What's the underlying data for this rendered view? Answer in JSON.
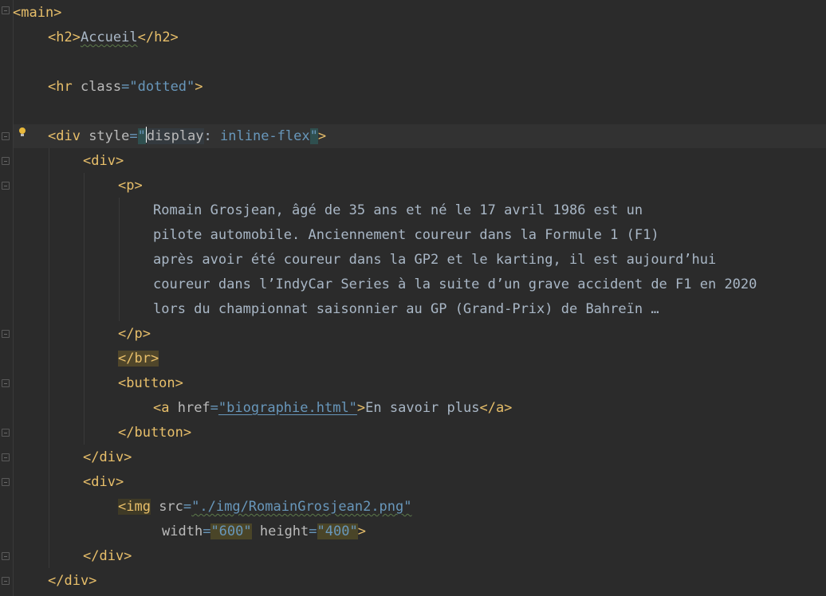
{
  "lines": {
    "l1": "<main>",
    "l2_open": "<h2>",
    "l2_text": "Accueil",
    "l2_close": "</h2>",
    "l3_tag": "<hr ",
    "l3_attr": "class",
    "l3_eq": "=",
    "l3_val": "\"dotted\"",
    "l3_end": ">",
    "l4_tag": "<div ",
    "l4_attr": "style",
    "l4_eq": "=",
    "l4_q1": "\"",
    "l4_prop": "display",
    "l4_colon": ": ",
    "l4_val": "inline-flex",
    "l4_q2": "\"",
    "l4_end": ">",
    "l5": "<div>",
    "l6": "<p>",
    "p1": "Romain Grosjean, âgé de 35 ans et né le 17 avril 1986 est un",
    "p2": "pilote automobile. Anciennement coureur dans la Formule 1 (F1)",
    "p3": "après avoir été coureur dans la GP2 et le karting, il est aujourd’hui",
    "p4": "coureur dans l’IndyCar Series à la suite d’un grave accident de F1 en 2020",
    "p5": "lors du championnat saisonnier au GP (Grand-Prix) de Bahreïn …",
    "l12": "</p>",
    "l13": "</br>",
    "l14": "<button>",
    "l15_tag": "<a ",
    "l15_attr": "href",
    "l15_eq": "=",
    "l15_val": "\"biographie.html\"",
    "l15_gt": ">",
    "l15_text": "En savoir plus",
    "l15_close": "</a>",
    "l16": "</button>",
    "l17": "</div>",
    "l18": "<div>",
    "l19_tag": "<img",
    "l19_attr": " src",
    "l19_eq": "=",
    "l19_val": "\"./img/RomainGrosjean2.png\"",
    "l20_attr1": "width",
    "l20_eq1": "=",
    "l20_val1": "\"600\"",
    "l20_attr2": " height",
    "l20_eq2": "=",
    "l20_val2": "\"400\"",
    "l20_end": ">",
    "l21": "</div>",
    "l22": "</div>"
  },
  "icons": {
    "intention": "lightbulb-icon",
    "fold": "fold-marker-icon"
  },
  "colors": {
    "background": "#2b2b2b",
    "tag": "#e8bf6a",
    "attribute": "#bababa",
    "string": "#6a8759",
    "value": "#6897bb",
    "text": "#a9b7c6"
  }
}
